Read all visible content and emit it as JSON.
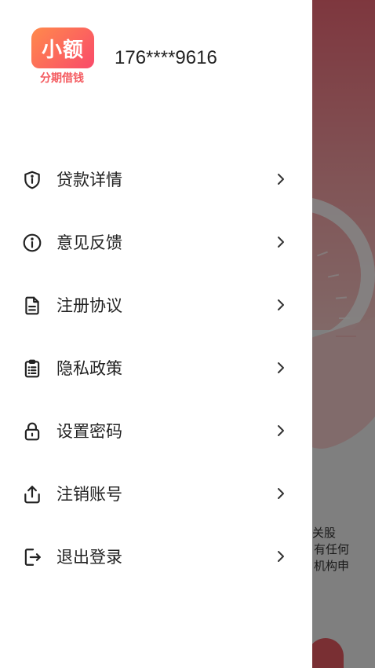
{
  "profile": {
    "logo_main": "小额",
    "logo_sub": "分期借钱",
    "phone": "176****9616"
  },
  "menu": {
    "items": [
      {
        "label": "贷款详情",
        "icon": "shield-info-icon"
      },
      {
        "label": "意见反馈",
        "icon": "info-circle-icon"
      },
      {
        "label": "注册协议",
        "icon": "document-icon"
      },
      {
        "label": "隐私政策",
        "icon": "clipboard-list-icon"
      },
      {
        "label": "设置密码",
        "icon": "lock-icon"
      },
      {
        "label": "注销账号",
        "icon": "share-upload-icon"
      },
      {
        "label": "退出登录",
        "icon": "logout-icon"
      }
    ],
    "chevron_icon": "chevron-right-icon"
  },
  "background": {
    "text_lines": [
      "关股",
      "有任何",
      "机构申"
    ]
  }
}
